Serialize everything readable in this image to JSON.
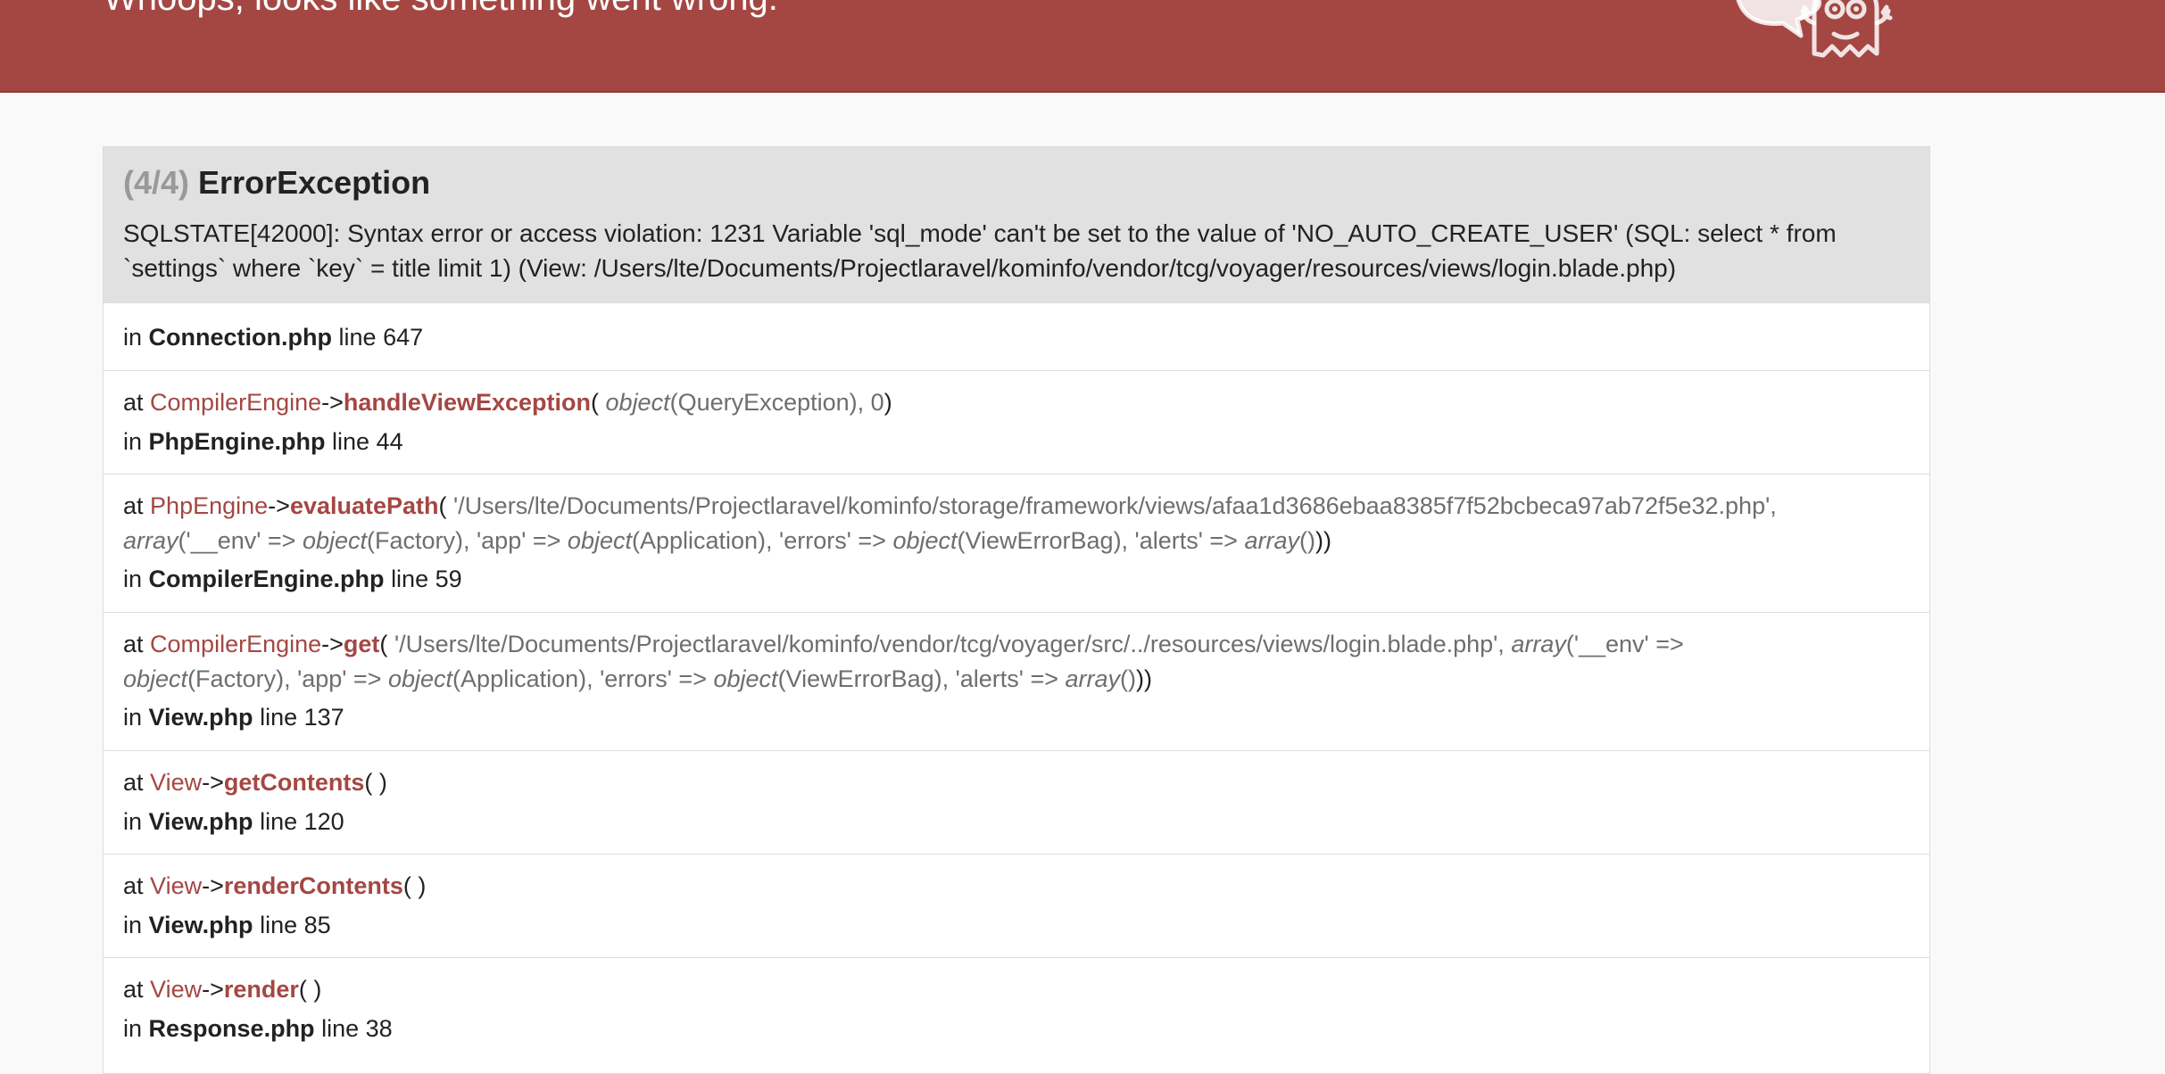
{
  "header": {
    "title": "Whoops, looks like something went wrong.",
    "background_color": "#a44743",
    "logo_icon": "ghost-icon"
  },
  "exception": {
    "count": "(4/4)",
    "class": "ErrorException",
    "message": "SQLSTATE[42000]: Syntax error or access violation: 1231 Variable 'sql_mode' can't be set to the value of 'NO_AUTO_CREATE_USER' (SQL: select * from `settings` where `key` = title limit 1) (View: /Users/lte/Documents/Projectlaravel/kominfo/vendor/tcg/voyager/resources/views/login.blade.php)"
  },
  "trace": {
    "origin": {
      "in": "in",
      "file": "Connection.php",
      "line_word": "line",
      "line": "647"
    },
    "frames": [
      {
        "at": "at",
        "class": "CompilerEngine",
        "arrow": "->",
        "method": "handleViewException",
        "open": "(",
        "close": ")",
        "arg1_type": "object",
        "arg1_rest": "(QueryException), 0",
        "in": "in",
        "file": "PhpEngine.php",
        "line_word": "line",
        "line": "44"
      },
      {
        "at": "at",
        "class": "PhpEngine",
        "arrow": "->",
        "method": "evaluatePath",
        "open": "(",
        "close": ")",
        "path": "'/Users/lte/Documents/Projectlaravel/kominfo/storage/framework/views/afaa1d3686ebaa8385f7f52bcbeca97ab72f5e32.php',",
        "array_word": "array",
        "env": "('__env' =>",
        "object_word": "object",
        "factory": "(Factory), 'app' =>",
        "application": "(Application), 'errors' =>",
        "viewerrorbag": "(ViewErrorBag), 'alerts' =>",
        "empty_array": "()",
        "in": "in",
        "file": "CompilerEngine.php",
        "line_word": "line",
        "line": "59"
      },
      {
        "at": "at",
        "class": "CompilerEngine",
        "arrow": "->",
        "method": "get",
        "open": "(",
        "close": ")",
        "path": "'/Users/lte/Documents/Projectlaravel/kominfo/vendor/tcg/voyager/src/../resources/views/login.blade.php',",
        "array_word": "array",
        "env": "('__env' =>",
        "object_word": "object",
        "factory": "(Factory), 'app' =>",
        "application": "(Application), 'errors' =>",
        "viewerrorbag": "(ViewErrorBag), 'alerts' =>",
        "empty_array": "()",
        "in": "in",
        "file": "View.php",
        "line_word": "line",
        "line": "137"
      },
      {
        "at": "at",
        "class": "View",
        "arrow": "->",
        "method": "getContents",
        "parens": "( )",
        "in": "in",
        "file": "View.php",
        "line_word": "line",
        "line": "120"
      },
      {
        "at": "at",
        "class": "View",
        "arrow": "->",
        "method": "renderContents",
        "parens": "( )",
        "in": "in",
        "file": "View.php",
        "line_word": "line",
        "line": "85"
      },
      {
        "at": "at",
        "class": "View",
        "arrow": "->",
        "method": "render",
        "parens": "( )",
        "in": "in",
        "file": "Response.php",
        "line_word": "line",
        "line": "38"
      }
    ]
  }
}
